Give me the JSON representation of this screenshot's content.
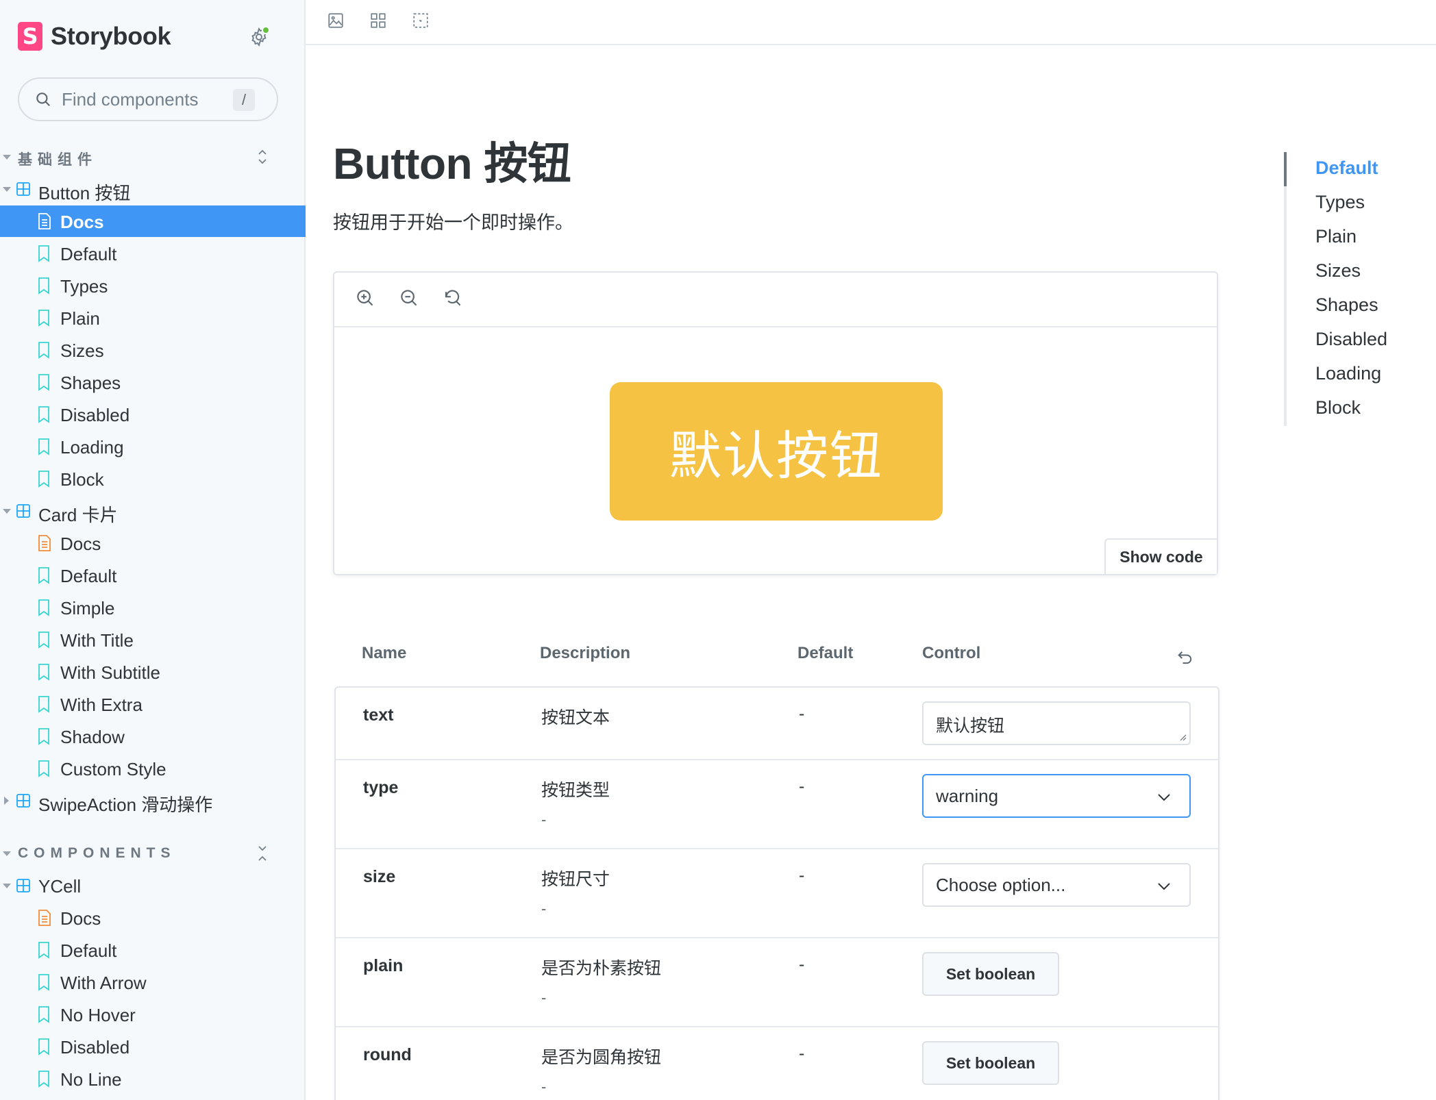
{
  "brand": {
    "name": "Storybook",
    "logo_letter": "S"
  },
  "search": {
    "placeholder": "Find components",
    "shortcut": "/"
  },
  "sidebar": {
    "groups": [
      {
        "label": "基础组件",
        "components": [
          {
            "label": "Button 按钮",
            "expanded": true,
            "items": [
              "Docs",
              "Default",
              "Types",
              "Plain",
              "Sizes",
              "Shapes",
              "Disabled",
              "Loading",
              "Block"
            ]
          },
          {
            "label": "Card 卡片",
            "expanded": true,
            "items": [
              "Docs",
              "Default",
              "Simple",
              "With Title",
              "With Subtitle",
              "With Extra",
              "Shadow",
              "Custom Style"
            ]
          },
          {
            "label": "SwipeAction 滑动操作",
            "expanded": false,
            "items": []
          }
        ]
      },
      {
        "label": "COMPONENTS",
        "components": [
          {
            "label": "YCell",
            "expanded": true,
            "items": [
              "Docs",
              "Default",
              "With Arrow",
              "No Hover",
              "Disabled",
              "No Line"
            ]
          }
        ]
      }
    ],
    "selected": "Docs"
  },
  "toolbar": {
    "icons": [
      "image-icon",
      "grid-icon",
      "outline-icon"
    ]
  },
  "doc": {
    "title": "Button 按钮",
    "description": "按钮用于开始一个即时操作。"
  },
  "preview": {
    "demo_button_label": "默认按钮",
    "demo_button_color": "#f5c243",
    "show_code_label": "Show code",
    "icons": [
      "zoom-in-icon",
      "zoom-out-icon",
      "reset-zoom-icon"
    ]
  },
  "toc": {
    "items": [
      "Default",
      "Types",
      "Plain",
      "Sizes",
      "Shapes",
      "Disabled",
      "Loading",
      "Block"
    ],
    "active": "Default"
  },
  "args_table": {
    "headers": {
      "name": "Name",
      "description": "Description",
      "default": "Default",
      "control": "Control"
    },
    "rows": [
      {
        "name": "text",
        "description": "按钮文本",
        "sub": "",
        "default": "-",
        "control": {
          "type": "text",
          "value": "默认按钮"
        }
      },
      {
        "name": "type",
        "description": "按钮类型",
        "sub": "-",
        "default": "-",
        "control": {
          "type": "select",
          "value": "warning",
          "focused": true
        }
      },
      {
        "name": "size",
        "description": "按钮尺寸",
        "sub": "-",
        "default": "-",
        "control": {
          "type": "select",
          "value": "Choose option...",
          "focused": false
        }
      },
      {
        "name": "plain",
        "description": "是否为朴素按钮",
        "sub": "-",
        "default": "-",
        "control": {
          "type": "boolean",
          "value": "Set boolean"
        }
      },
      {
        "name": "round",
        "description": "是否为圆角按钮",
        "sub": "-",
        "default": "-",
        "control": {
          "type": "boolean",
          "value": "Set boolean"
        }
      }
    ]
  },
  "colors": {
    "accent": "#4096f5",
    "brand": "#ff4785",
    "status_dot": "#66bf3c",
    "component_icon": "#1ea7fd",
    "story_icon": "#37d5d3",
    "docs_icon": "#f28c38"
  }
}
